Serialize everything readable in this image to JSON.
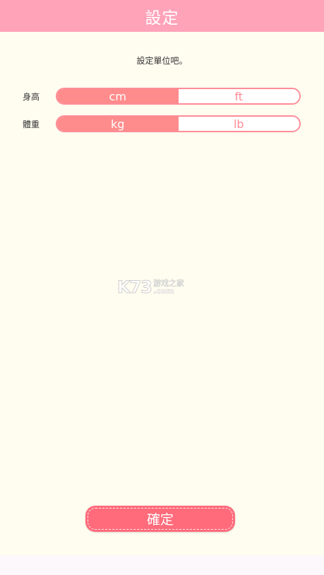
{
  "header": {
    "title": "設定",
    "color": "#ffa3b9"
  },
  "instruction": "設定單位吧。",
  "settings": {
    "height": {
      "label": "身高",
      "options": [
        "cm",
        "ft"
      ],
      "selected": "cm"
    },
    "weight": {
      "label": "體重",
      "options": [
        "kg",
        "lb"
      ],
      "selected": "kg"
    }
  },
  "watermark": {
    "logo": "K73",
    "cn": "游戏之家",
    "com": ".com"
  },
  "confirm_button": {
    "label": "確定",
    "color": "#ff6b7b"
  },
  "colors": {
    "active_segment": "#ff8c8c",
    "toggle_border": "#ff8c97",
    "background": "#fffdf0"
  }
}
